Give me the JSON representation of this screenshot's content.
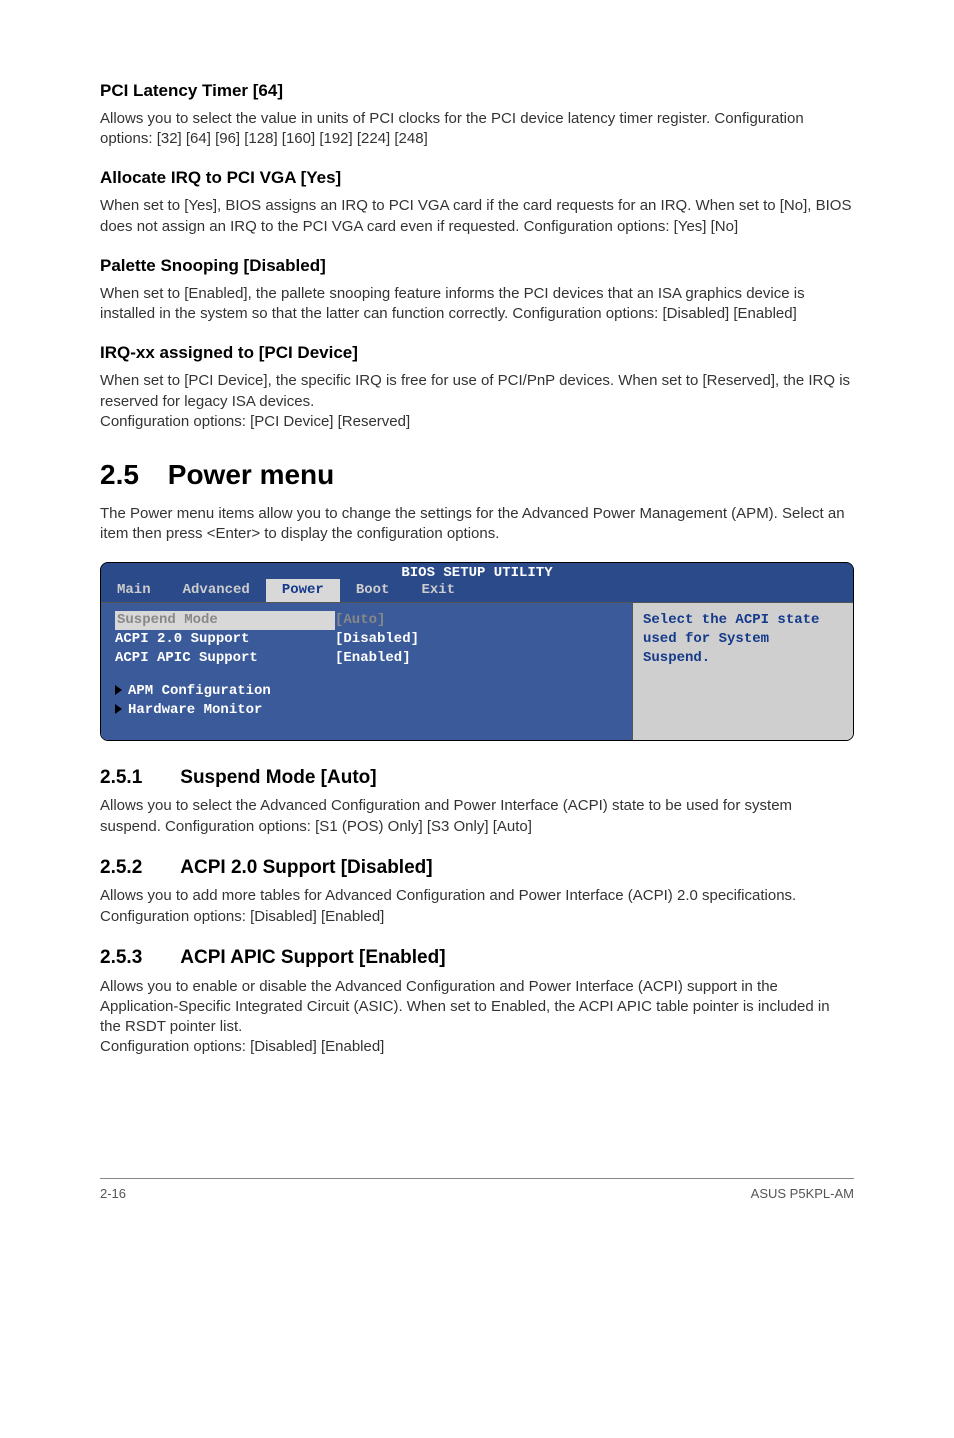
{
  "sections": [
    {
      "title": "PCI Latency Timer [64]",
      "body": "Allows you to select the value in units of PCI clocks for the PCI device latency timer register. Configuration options: [32] [64] [96] [128] [160] [192] [224] [248]"
    },
    {
      "title": "Allocate IRQ to PCI VGA [Yes]",
      "body": "When set to [Yes], BIOS assigns an IRQ to PCI VGA card if the card requests for an IRQ. When set to [No], BIOS does not assign an IRQ to the PCI VGA card even if requested. Configuration options: [Yes] [No]"
    },
    {
      "title": "Palette Snooping [Disabled]",
      "body": "When set to [Enabled], the pallete snooping feature informs the PCI devices that an ISA graphics device is installed in the system so that the latter can function correctly. Configuration options: [Disabled] [Enabled]"
    },
    {
      "title": "IRQ-xx assigned to [PCI Device]",
      "body": "When set to [PCI Device], the specific IRQ is free for use of PCI/PnP devices. When set to [Reserved], the IRQ is reserved for legacy ISA devices.\nConfiguration options: [PCI Device] [Reserved]"
    }
  ],
  "main_heading": {
    "num": "2.5",
    "title": "Power menu"
  },
  "main_body": "The Power menu items allow you to change the settings for the Advanced Power Management (APM). Select an item then press <Enter> to display the configuration options.",
  "bios": {
    "title": "BIOS SETUP UTILITY",
    "tabs": [
      "Main",
      "Advanced",
      "Power",
      "Boot",
      "Exit"
    ],
    "active_tab": "Power",
    "rows": [
      {
        "label": "Suspend Mode",
        "value": "[Auto]",
        "selected": true
      },
      {
        "label": "ACPI 2.0 Support",
        "value": "[Disabled]"
      },
      {
        "label": "ACPI APIC Support",
        "value": "[Enabled]"
      }
    ],
    "submenus": [
      "APM Configuration",
      "Hardware Monitor"
    ],
    "help": "Select the ACPI state used for System Suspend."
  },
  "sub_sections": [
    {
      "num": "2.5.1",
      "title": "Suspend Mode [Auto]",
      "body": "Allows you to select the Advanced Configuration and Power Interface (ACPI) state to be used for system suspend. Configuration options: [S1 (POS) Only] [S3 Only] [Auto]"
    },
    {
      "num": "2.5.2",
      "title": "ACPI 2.0 Support [Disabled]",
      "body": "Allows you to add more tables for Advanced Configuration and Power Interface (ACPI) 2.0 specifications. Configuration options: [Disabled] [Enabled]"
    },
    {
      "num": "2.5.3",
      "title": "ACPI APIC Support [Enabled]",
      "body": "Allows you to enable or disable the Advanced Configuration and Power Interface (ACPI) support in the Application-Specific Integrated Circuit (ASIC). When set to Enabled, the ACPI APIC table pointer is included in the RSDT pointer list.\nConfiguration options: [Disabled] [Enabled]"
    }
  ],
  "footer": {
    "left": "2-16",
    "right": "ASUS P5KPL-AM"
  }
}
